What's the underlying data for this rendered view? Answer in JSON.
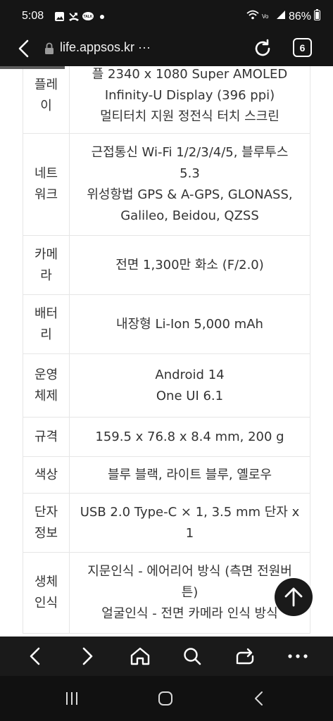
{
  "status_bar": {
    "time": "5:08",
    "battery": "86%"
  },
  "address_bar": {
    "url": "life.appsos.kr ···",
    "tab_count": "6"
  },
  "spec_rows": [
    {
      "label": [
        "플레",
        "이"
      ],
      "value": [
        "플 2340 x 1080 Super AMOLED",
        "Infinity-U Display (396 ppi)",
        "멀티터치 지원 정전식 터치 스크린"
      ]
    },
    {
      "label": [
        "네트",
        "워크"
      ],
      "value": [
        "근접통신 Wi-Fi 1/2/3/4/5, 블루투스",
        "5.3",
        "위성항법 GPS & A-GPS, GLONASS,",
        "Galileo, Beidou, QZSS"
      ]
    },
    {
      "label": [
        "카메",
        "라"
      ],
      "value": [
        "전면 1,300만 화소 (F/2.0)"
      ]
    },
    {
      "label": [
        "배터",
        "리"
      ],
      "value": [
        "내장형 Li-Ion 5,000 mAh"
      ]
    },
    {
      "label": [
        "운영",
        "체제"
      ],
      "value": [
        "Android 14",
        "One UI 6.1"
      ]
    },
    {
      "label": [
        "규격"
      ],
      "value": [
        "159.5 x 76.8 x 8.4 mm, 200 g"
      ]
    },
    {
      "label": [
        "색상"
      ],
      "value": [
        "블루 블랙, 라이트 블루, 옐로우"
      ]
    },
    {
      "label": [
        "단자",
        "정보"
      ],
      "value": [
        "USB 2.0 Type-C × 1, 3.5 mm 단자 x",
        "1"
      ]
    },
    {
      "label": [
        "생체",
        "인식"
      ],
      "value": [
        "지문인식 - 에어리어 방식 (측면 전원버",
        "튼)",
        "얼굴인식 - 전면 카메라 인식 방식"
      ]
    }
  ],
  "icons": {
    "back": "back-arrow-icon",
    "lock": "lock-icon",
    "reload": "reload-icon",
    "scroll_top": "arrow-up-icon",
    "toolbar": [
      "chevron-left-icon",
      "chevron-right-icon",
      "home-icon",
      "search-icon",
      "share-icon",
      "more-icon"
    ],
    "nav": [
      "recents-icon",
      "home-nav-icon",
      "back-nav-icon"
    ]
  }
}
